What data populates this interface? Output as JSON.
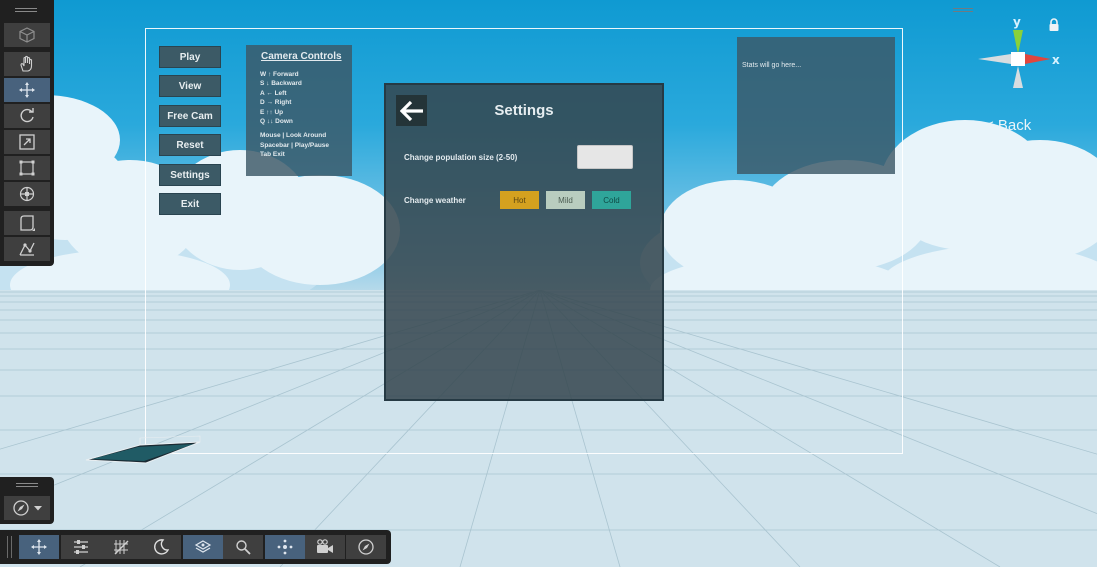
{
  "game_menu": {
    "buttons": [
      {
        "label": "Play"
      },
      {
        "label": "View"
      },
      {
        "label": "Free Cam"
      },
      {
        "label": "Reset"
      },
      {
        "label": "Settings"
      },
      {
        "label": "Exit"
      }
    ]
  },
  "camera_controls": {
    "title": "Camera Controls",
    "lines": [
      "W ↑ Forward",
      "S ↓ Backward",
      "A ← Left",
      "D → Right",
      "E ↑↑ Up",
      "Q ↓↓ Down"
    ],
    "extra_lines": [
      "Mouse | Look Around",
      "Spacebar | Play/Pause",
      "Tab Exit"
    ]
  },
  "stats_panel": {
    "text": "Stats will go here..."
  },
  "settings": {
    "title": "Settings",
    "back_icon": "arrow-left-icon",
    "population_label": "Change population size  (2-50)",
    "population_value": "",
    "weather_label": "Change weather",
    "weather_options": [
      {
        "label": "Hot",
        "color": "#d4a11f",
        "text_color": "#5a4510"
      },
      {
        "label": "Mild",
        "color": "#b9cdbf",
        "text_color": "#4c5d52"
      },
      {
        "label": "Cold",
        "color": "#2fa59a",
        "text_color": "#0f4b46"
      }
    ]
  },
  "scene_gizmo": {
    "axis_y": "y",
    "axis_x": "x",
    "back_label": "< Back",
    "colors": {
      "y": "#89d13a",
      "x": "#e0463e",
      "neutral": "#d8dde0"
    }
  },
  "tools": {
    "left": [
      "cube-icon",
      "hand-icon",
      "move-icon",
      "rotate-icon",
      "scale-icon",
      "rect-tool-icon",
      "transform-icon",
      "view-options-icon",
      "custom-tool-icon"
    ],
    "bottom": [
      "move-icon",
      "sliders-icon",
      "grid-icon",
      "moon-icon",
      "layers-icon",
      "search-icon",
      "points-icon",
      "camera-icon",
      "compass-icon"
    ]
  },
  "colors": {
    "panel_bg": "#3c5a66",
    "toolbar_bg": "#202020",
    "tool_button": "#3f3f3f",
    "tool_active": "#48627d"
  }
}
